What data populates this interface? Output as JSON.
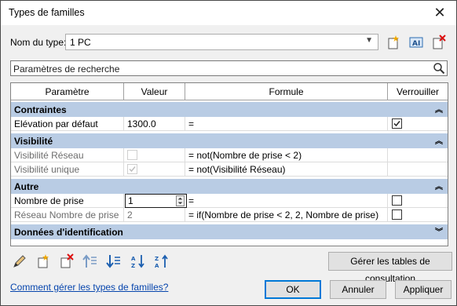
{
  "window": {
    "title": "Types de familles",
    "close_glyph": "✕"
  },
  "type_row": {
    "label": "Nom du type:",
    "value": "1 PC"
  },
  "search": {
    "placeholder": "Paramètres de recherche"
  },
  "table": {
    "headers": [
      "Paramètre",
      "Valeur",
      "Formule",
      "Verrouiller"
    ],
    "groups": {
      "contraintes": "Contraintes",
      "visibilite": "Visibilité",
      "autre": "Autre",
      "donnees": "Données d'identification"
    },
    "rows": {
      "elevation": {
        "param": "Elévation par défaut",
        "value": "1300.0",
        "formula": "=",
        "locked": true
      },
      "vis_reseau": {
        "param": "Visibilité Réseau",
        "value": "",
        "formula": "= not(Nombre de prise < 2)",
        "checked": false
      },
      "vis_unique": {
        "param": "Visibilité unique",
        "value": "",
        "formula": "= not(Visibilité Réseau)",
        "checked": true
      },
      "nb_prise": {
        "param": "Nombre de prise",
        "value": "1",
        "formula": "=",
        "locked": false
      },
      "reseau_nb": {
        "param": "Réseau Nombre de prise",
        "value": "2",
        "formula": "= if(Nombre de prise < 2, 2, Nombre de prise)",
        "locked": false
      }
    }
  },
  "buttons": {
    "manage_tables": "Gérer les tables de consultation",
    "ok": "OK",
    "cancel": "Annuler",
    "apply": "Appliquer"
  },
  "help_link": "Comment gérer les types de familles?",
  "icons": {
    "toolbar_top": [
      "new-type-icon",
      "rename-type-icon",
      "delete-type-icon"
    ],
    "toolbar_bottom": [
      "edit-parameter-icon",
      "new-parameter-icon",
      "delete-parameter-icon",
      "move-up-icon",
      "move-down-icon",
      "sort-ascending-icon",
      "sort-descending-icon"
    ]
  },
  "colors": {
    "group_band": "#b9cce4",
    "accent": "#0078d7",
    "link": "#0645ad"
  }
}
